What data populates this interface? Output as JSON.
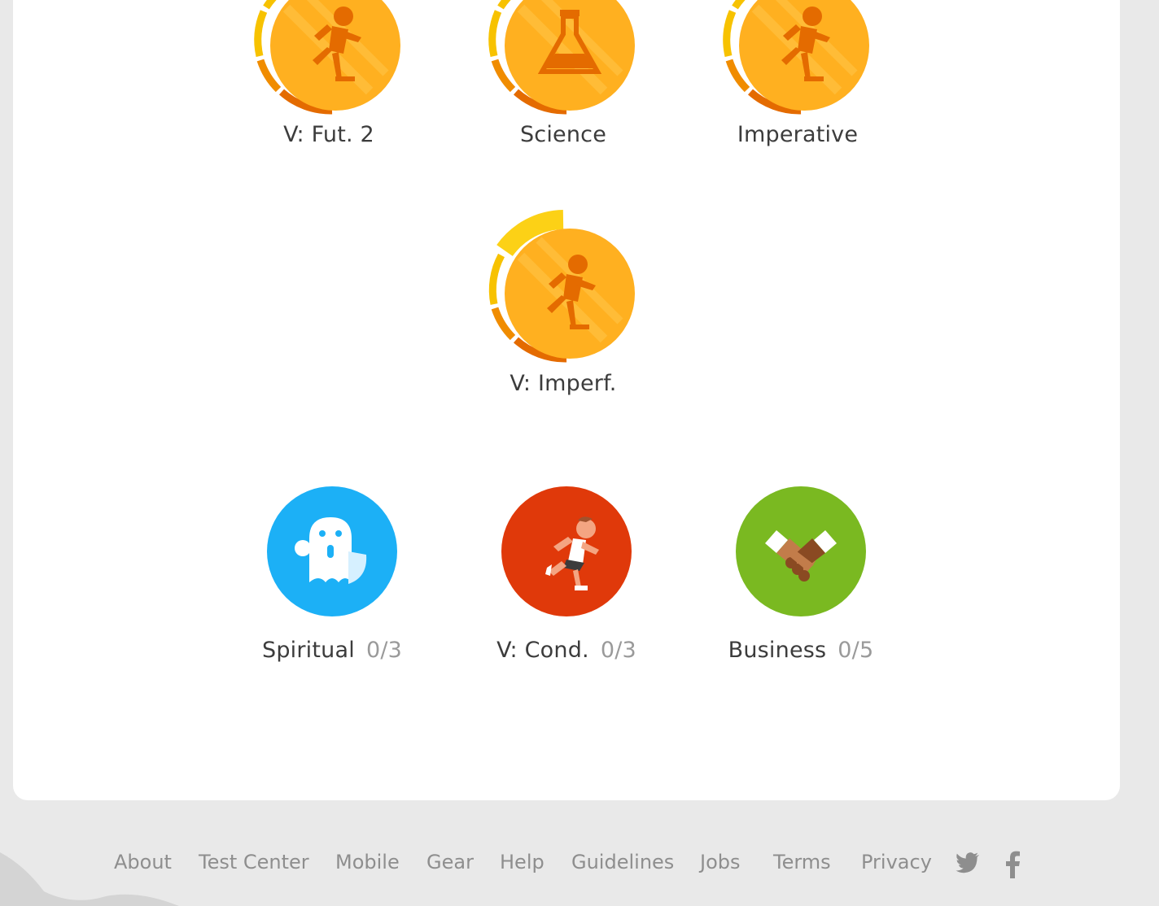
{
  "skills": [
    {
      "label": "V: Fut. 2",
      "count": "",
      "icon": "running-person-icon",
      "state": "gold"
    },
    {
      "label": "Science",
      "count": "",
      "icon": "flask-icon",
      "state": "gold"
    },
    {
      "label": "Imperative",
      "count": "",
      "icon": "running-person-icon",
      "state": "gold"
    },
    {
      "label": "V: Imperf.",
      "count": "",
      "icon": "running-person-icon",
      "state": "gold"
    },
    {
      "label": "Spiritual",
      "count": "0/3",
      "icon": "ghost-icon",
      "state": "unstarted",
      "color": "#1cb0f6"
    },
    {
      "label": "V: Cond.",
      "count": "0/3",
      "icon": "running-person-icon",
      "state": "unstarted",
      "color": "#e0390a"
    },
    {
      "label": "Business",
      "count": "0/5",
      "icon": "handshake-icon",
      "state": "unstarted",
      "color": "#7ab921"
    }
  ],
  "footer": {
    "links": [
      "About",
      "Test Center",
      "Mobile",
      "Gear",
      "Help",
      "Guidelines",
      "Jobs",
      "Terms",
      "Privacy"
    ],
    "social": [
      "twitter-icon",
      "facebook-icon"
    ]
  },
  "colors": {
    "gold": "#ffb020",
    "gold_dark": "#e46b00",
    "ring_yellow": "#f7c200",
    "ring_orange": "#f08c00",
    "footer_text": "#8e8e8e",
    "label_text": "#3c3c3c"
  }
}
